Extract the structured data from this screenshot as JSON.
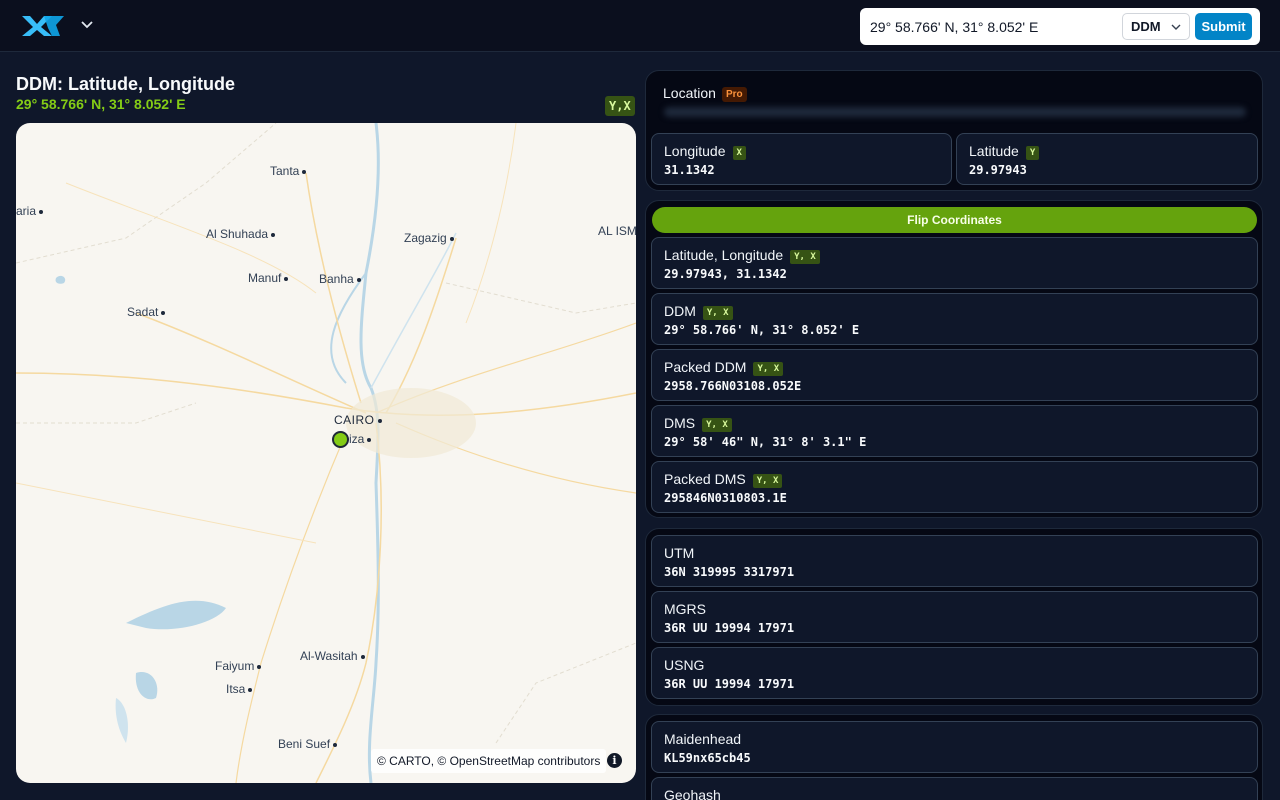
{
  "header": {
    "logo_text": "YX",
    "search_value": "29° 58.766' N, 31° 8.052' E",
    "format_selected": "DDM",
    "submit_label": "Submit"
  },
  "left": {
    "title": "DDM: Latitude, Longitude",
    "subtitle": "29° 58.766' N, 31° 8.052' E",
    "order_badge": "Y,X"
  },
  "map": {
    "cities": [
      "Tanta",
      "aria",
      "Al Shuhada",
      "Zagazig",
      "AL ISM",
      "Manuf",
      "Banha",
      "Sadat",
      "CAIRO",
      "iza",
      "Faiyum",
      "Al-Wasitah",
      "Itsa",
      "Beni Suef"
    ],
    "attribution": "© CARTO, © OpenStreetMap contributors",
    "info_glyph": "i",
    "marker_color": "#84cc16"
  },
  "location_panel": {
    "label": "Location",
    "pro_badge": "Pro",
    "longitude_label": "Longitude",
    "longitude_tag": "X",
    "longitude_value": "31.1342",
    "latitude_label": "Latitude",
    "latitude_tag": "Y",
    "latitude_value": "29.97943"
  },
  "formats_panel": {
    "flip_label": "Flip Coordinates",
    "items": [
      {
        "label": "Latitude, Longitude",
        "tag": "Y, X",
        "value": "29.97943, 31.1342"
      },
      {
        "label": "DDM",
        "tag": "Y, X",
        "value": "29° 58.766' N, 31° 8.052' E"
      },
      {
        "label": "Packed DDM",
        "tag": "Y, X",
        "value": "2958.766N03108.052E"
      },
      {
        "label": "DMS",
        "tag": "Y, X",
        "value": "29° 58' 46\" N, 31° 8' 3.1\" E"
      },
      {
        "label": "Packed DMS",
        "tag": "Y, X",
        "value": "295846N0310803.1E"
      }
    ]
  },
  "grid_panel": {
    "items": [
      {
        "label": "UTM",
        "value": "36N 319995 3317971"
      },
      {
        "label": "MGRS",
        "value": "36R UU 19994 17971"
      },
      {
        "label": "USNG",
        "value": "36R UU 19994 17971"
      }
    ]
  },
  "hash_panel": {
    "items": [
      {
        "label": "Maidenhead",
        "value": "KL59nx65cb45"
      },
      {
        "label": "Geohash",
        "value": ""
      }
    ]
  },
  "colors": {
    "accent_green": "#65a30d",
    "badge_green_bg": "#365314",
    "submit_blue": "#0284c7",
    "page_bg": "#0f172a"
  }
}
